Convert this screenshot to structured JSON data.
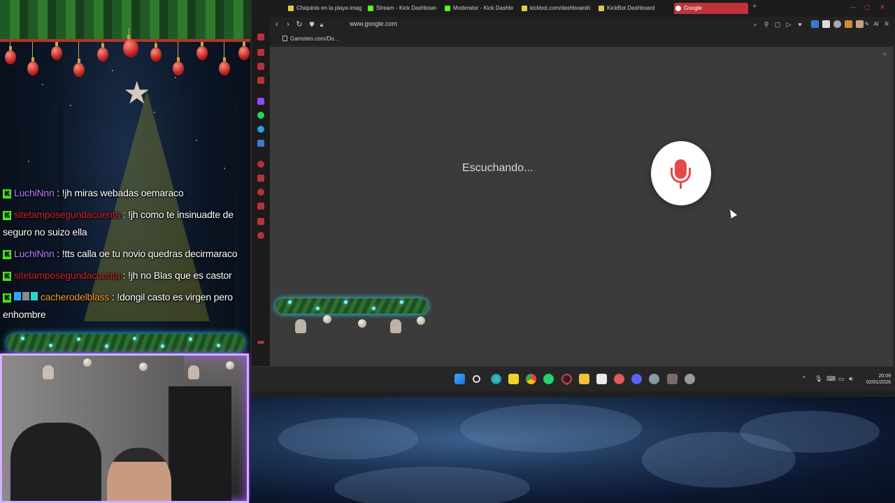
{
  "chat": {
    "messages": [
      {
        "user": "LuchiNnn",
        "user_color": "#b97dff",
        "text": ": !jh miras webadas oemaraco"
      },
      {
        "user": "sitetamposegundacuenta",
        "user_color": "#d0202a",
        "text": ": !jh como te insinuadte de seguro no suizo ella"
      },
      {
        "user": "LuchiNnn",
        "user_color": "#b97dff",
        "text": ": !tts calla oe tu novio quedras decirmaraco"
      },
      {
        "user": "sitetamposegundacuenta",
        "user_color": "#d0202a",
        "text": ": !jh no Blas que es castor"
      },
      {
        "user": "cacherodelblass",
        "user_color": "#f29b2a",
        "text": ": !dongil casto es virgen pero enhombre"
      }
    ]
  },
  "browser": {
    "tabs": [
      {
        "label": "Chiquinis en la playa imag",
        "icon_color": "#e8c84a"
      },
      {
        "label": "Stream - Kick Dashboard",
        "icon_color": "#53fc18"
      },
      {
        "label": "Moderator - Kick Dashbo",
        "icon_color": "#53fc18"
      },
      {
        "label": "kickbot.com/dashboard/m",
        "icon_color": "#e8c84a"
      },
      {
        "label": "KickBot Dashboard",
        "icon_color": "#e8c84a"
      },
      {
        "label": "Google",
        "icon_color": "#ffffff"
      }
    ],
    "new_tab": "+",
    "url": "www.google.com",
    "bookmark": "Gamoten.com/Do...",
    "listening_text": "Escuchando...",
    "close_symbol": "×",
    "ai_label": "AI"
  },
  "taskbar": {
    "time": "20:09",
    "date": "02/01/2026"
  },
  "colors": {
    "kick_green": "#53fc18",
    "mic_red": "#e44a4a",
    "active_tab": "#c0323a",
    "webcam_border": "#d7b0ff"
  }
}
